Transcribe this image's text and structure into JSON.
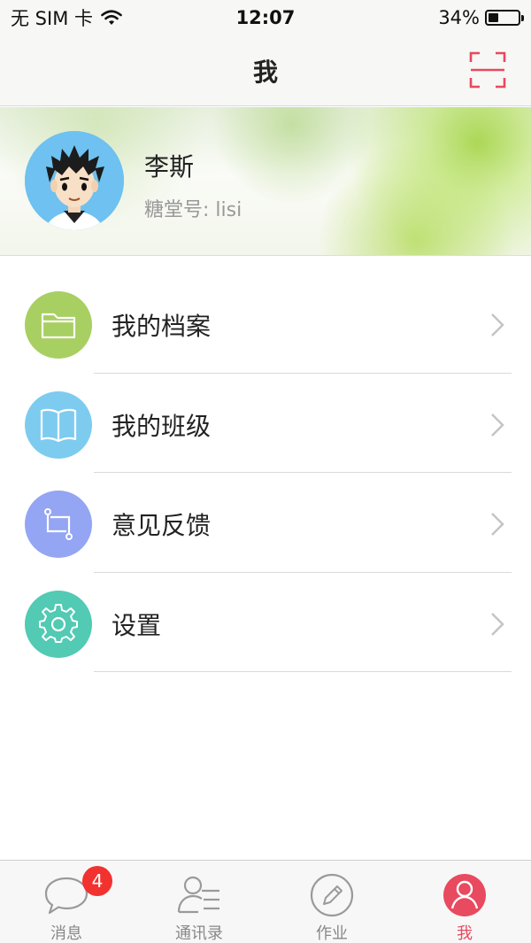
{
  "status_bar": {
    "carrier": "无 SIM 卡",
    "time": "12:07",
    "battery_percent": "34%",
    "battery_level": 0.34
  },
  "nav": {
    "title": "我",
    "scan_icon": "scan-qr-icon"
  },
  "profile": {
    "name": "李斯",
    "id_text": "糖堂号: lisi",
    "avatar": "cartoon-boy-avatar"
  },
  "menu": {
    "items": [
      {
        "label": "我的档案",
        "icon": "folder-icon",
        "color": "#a8cf62"
      },
      {
        "label": "我的班级",
        "icon": "book-icon",
        "color": "#7ecbf0"
      },
      {
        "label": "意见反馈",
        "icon": "feedback-icon",
        "color": "#94a5f4"
      },
      {
        "label": "设置",
        "icon": "gear-icon",
        "color": "#52cab4"
      }
    ]
  },
  "tab_bar": {
    "tabs": [
      {
        "label": "消息",
        "icon": "chat-bubble-icon",
        "badge": "4"
      },
      {
        "label": "通讯录",
        "icon": "contacts-icon"
      },
      {
        "label": "作业",
        "icon": "pencil-icon"
      },
      {
        "label": "我",
        "icon": "profile-icon",
        "active": true
      }
    ],
    "active_color": "#e84a5f"
  }
}
